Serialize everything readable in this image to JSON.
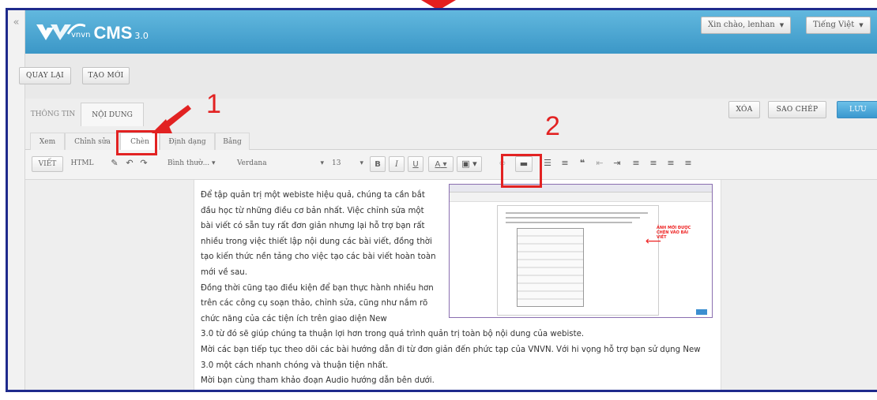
{
  "header": {
    "brand_small": "vnvn",
    "brand_name": "CMS",
    "brand_version": "3.0",
    "greeting": "Xin chào, lenhan",
    "language": "Tiếng Việt",
    "collapse_icon": "«"
  },
  "top_actions": {
    "back": "QUAY LẠI",
    "new": "TẠO MỚI"
  },
  "main_tabs": {
    "info": "THÔNG TIN",
    "content": "NỘI DUNG"
  },
  "right_actions": {
    "delete": "XÓA",
    "copy": "SAO CHÉP",
    "save": "LƯU"
  },
  "sub_tabs": [
    "Xem",
    "Chỉnh sửa",
    "Chèn",
    "Định dạng",
    "Bảng"
  ],
  "toolbar": {
    "view_label": "VIẾT",
    "html_label": "HTML",
    "style_select": "Bình thườ...",
    "font_select": "Verdana",
    "size_select": "13",
    "bold": "B",
    "italic": "I",
    "underline": "U",
    "font_color": "A"
  },
  "annotations": {
    "num1": "1",
    "num2": "2"
  },
  "editor": {
    "paragraphs": [
      "Để tập quản trị một webiste hiệu quả, chúng ta cần bắt đầu học từ những điều cơ bản nhất. Việc chỉnh sửa một bài viết có sẵn tuy rất đơn giản nhưng lại hỗ trợ bạn rất nhiều trong việc thiết lập nội dung các bài viết, đồng thời tạo kiến thức nền tảng cho việc tạo các bài viết hoàn toàn mới về sau.",
      "Đồng thời cũng tạo điều kiện để bạn thực hành nhiều hơn trên các công cụ soạn thảo, chỉnh sửa, cũng như nắm rõ chức năng của các tiện ích trên giao diện New",
      "3.0 từ đó sẽ giúp chúng ta thuận lợi hơn trong quá trình quản trị toàn bộ nội dung của webiste.",
      "Mời các bạn tiếp tục theo dõi các bài hướng dẫn đi từ đơn giản đến phức tạp của VNVN. Với hi vọng hỗ trợ bạn sử dụng New 3.0 một cách nhanh chóng và thuận tiện nhất.",
      "Mời bạn cùng tham khảo đoạn Audio hướng dẫn bên dưới."
    ],
    "image_caption": "ẢNH MỚI ĐƯỢC CHÈN VÀO BÀI VIẾT"
  },
  "colors": {
    "header_blue": "#3b97c7",
    "annotation_red": "#e22222",
    "frame_navy": "#1e2a8c",
    "save_blue": "#3a98cf"
  }
}
